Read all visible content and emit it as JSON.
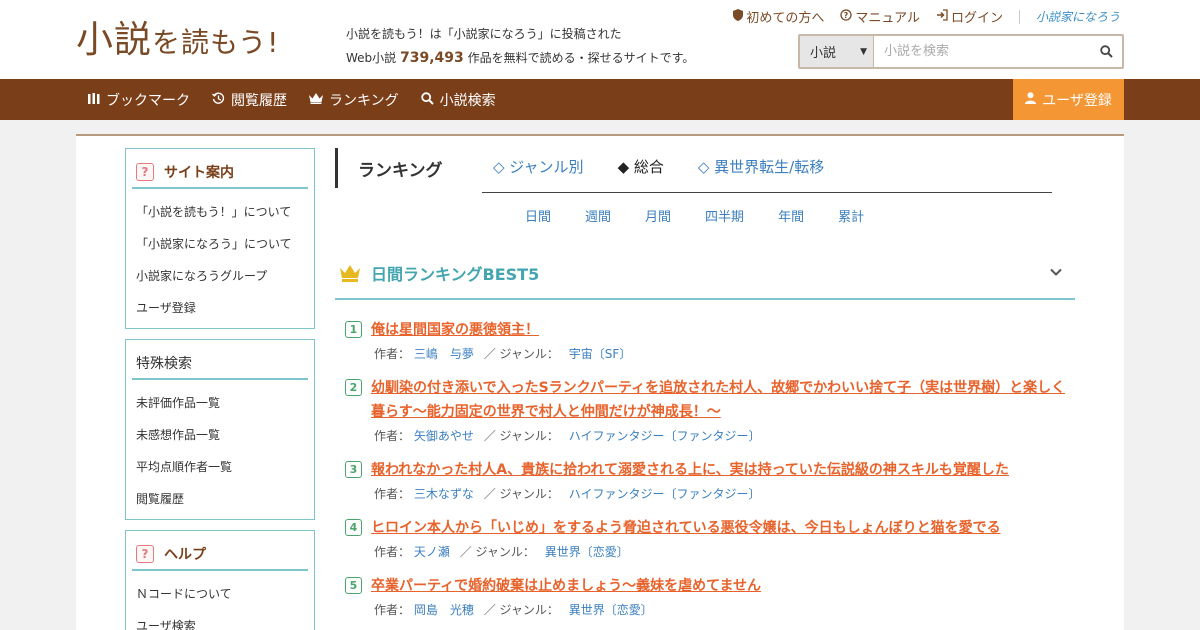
{
  "header": {
    "logo_main": "小説",
    "logo_small": "を読もう!",
    "tagline_line1": "小説を読もう！は「小説家になろう」に投稿された",
    "tagline_prefix": "Web小説",
    "tagline_count": "739,493",
    "tagline_suffix": "作品を無料で読める・探せるサイトです。",
    "links": [
      {
        "label": "初めての方へ",
        "icon": "shield-icon"
      },
      {
        "label": "マニュアル",
        "icon": "question-circle-icon"
      },
      {
        "label": "ログイン",
        "icon": "login-icon"
      }
    ],
    "brand_link": "小説家になろう",
    "search": {
      "select_value": "小説",
      "placeholder": "小説を検索"
    }
  },
  "nav": {
    "items": [
      {
        "label": "ブックマーク",
        "icon": "bookmark-icon"
      },
      {
        "label": "閲覧履歴",
        "icon": "history-icon"
      },
      {
        "label": "ランキング",
        "icon": "crown-icon"
      },
      {
        "label": "小説検索",
        "icon": "search-icon"
      }
    ],
    "register": "ユーザ登録"
  },
  "sidebar": {
    "boxes": [
      {
        "title": "サイト案内",
        "icon": "question-icon",
        "items": [
          "「小説を読もう！」について",
          "「小説家になろう」について",
          "小説家になろうグループ",
          "ユーザ登録"
        ]
      },
      {
        "title": "特殊検索",
        "items": [
          "未評価作品一覧",
          "未感想作品一覧",
          "平均点順作者一覧",
          "閲覧履歴"
        ]
      },
      {
        "title": "ヘルプ",
        "icon": "question-icon",
        "items": [
          "Ｎコードについて",
          "ユーザ検索"
        ]
      }
    ]
  },
  "ranking": {
    "title": "ランキング",
    "tabs": [
      {
        "label": "◇ ジャンル別",
        "active": false
      },
      {
        "label": "◆ 総合",
        "active": true
      },
      {
        "label": "◇ 異世界転生/転移",
        "active": false
      }
    ],
    "periods": [
      "日間",
      "週間",
      "月間",
      "四半期",
      "年間",
      "累計"
    ],
    "best_title": "日間ランキングBEST5",
    "author_label": "作者：",
    "genre_label": "／ ジャンル：",
    "items": [
      {
        "rank": "1",
        "title": "俺は星間国家の悪徳領主！",
        "author": "三嶋　与夢",
        "genre": "宇宙〔SF〕"
      },
      {
        "rank": "2",
        "title": "幼馴染の付き添いで入ったSランクパーティを追放された村人、故郷でかわいい捨て子（実は世界樹）と楽しく暮らす～能力固定の世界で村人と仲間だけが神成長！～",
        "author": "矢御あやせ",
        "genre": "ハイファンタジー〔ファンタジー〕"
      },
      {
        "rank": "3",
        "title": "報われなかった村人A、貴族に拾われて溺愛される上に、実は持っていた伝説級の神スキルも覚醒した",
        "author": "三木なずな",
        "genre": "ハイファンタジー〔ファンタジー〕"
      },
      {
        "rank": "4",
        "title": "ヒロイン本人から「いじめ」をするよう脅迫されている悪役令嬢は、今日もしょんぼりと猫を愛でる",
        "author": "天ノ瀬",
        "genre": "異世界〔恋愛〕"
      },
      {
        "rank": "5",
        "title": "卒業パーティで婚約破棄は止めましょう～義妹を虐めてません",
        "author": "岡島　光穂",
        "genre": "異世界〔恋愛〕"
      }
    ]
  }
}
